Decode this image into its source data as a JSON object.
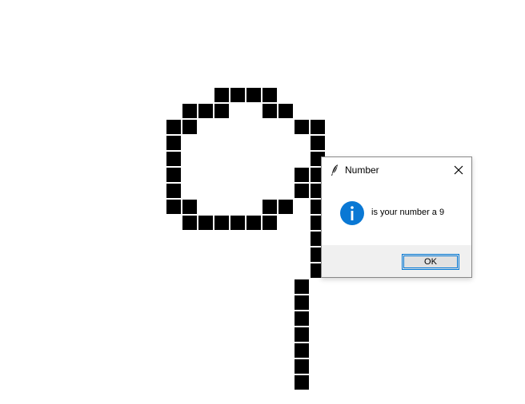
{
  "canvas": {
    "digit_grid": [
      [
        1,
        6
      ],
      [
        1,
        7
      ],
      [
        1,
        8
      ],
      [
        1,
        9
      ],
      [
        2,
        4
      ],
      [
        2,
        5
      ],
      [
        2,
        6
      ],
      [
        2,
        9
      ],
      [
        2,
        10
      ],
      [
        3,
        3
      ],
      [
        3,
        4
      ],
      [
        3,
        11
      ],
      [
        3,
        12
      ],
      [
        4,
        3
      ],
      [
        4,
        12
      ],
      [
        5,
        3
      ],
      [
        5,
        12
      ],
      [
        6,
        3
      ],
      [
        6,
        11
      ],
      [
        6,
        12
      ],
      [
        7,
        3
      ],
      [
        7,
        11
      ],
      [
        7,
        12
      ],
      [
        8,
        3
      ],
      [
        8,
        4
      ],
      [
        8,
        9
      ],
      [
        8,
        10
      ],
      [
        8,
        12
      ],
      [
        9,
        4
      ],
      [
        9,
        5
      ],
      [
        9,
        6
      ],
      [
        9,
        7
      ],
      [
        9,
        8
      ],
      [
        9,
        9
      ],
      [
        9,
        12
      ],
      [
        10,
        12
      ],
      [
        11,
        12
      ],
      [
        12,
        12
      ],
      [
        13,
        11
      ],
      [
        14,
        11
      ],
      [
        15,
        11
      ],
      [
        16,
        11
      ],
      [
        17,
        11
      ],
      [
        18,
        11
      ],
      [
        19,
        11
      ]
    ],
    "fill_color": "#000000"
  },
  "dialog": {
    "title": "Number",
    "title_icon": "feather-icon",
    "close_icon": "close-icon",
    "message_icon": "info-icon",
    "message": "is your number a 9",
    "ok_label": "OK",
    "accent_color": "#0078d7"
  }
}
